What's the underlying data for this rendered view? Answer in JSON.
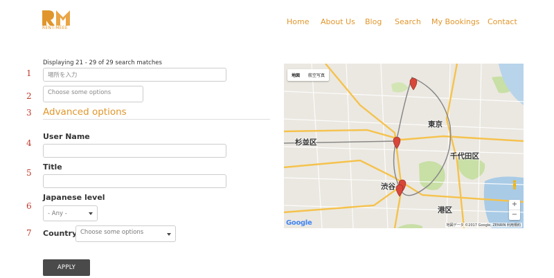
{
  "header": {
    "logo_text": "RENT-MEEE",
    "nav": [
      "Home",
      "About Us",
      "Blog",
      "Search",
      "My Bookings",
      "Contact"
    ]
  },
  "results": {
    "count_text": "Displaying 21 - 29 of 29 search matches"
  },
  "row_numbers": [
    "1",
    "2",
    "3",
    "4",
    "5",
    "6",
    "7"
  ],
  "form": {
    "location_placeholder": "場所を入力",
    "options_placeholder": "Choose some options",
    "advanced_title": "Advanced options",
    "user_name_label": "User Name",
    "user_name_value": "",
    "title_label": "Title",
    "title_value": "",
    "japanese_level_label": "Japanese level",
    "japanese_level_value": "- Any -",
    "country_label": "Country",
    "country_placeholder": "Choose some options",
    "apply_label": "APPLY"
  },
  "map": {
    "toggle": [
      "地図",
      "航空写真"
    ],
    "labels": [
      "東京",
      "杉並区",
      "千代田区",
      "渋谷",
      "港区"
    ],
    "zoom_in": "+",
    "zoom_out": "−",
    "google_logo": "Google",
    "attribution": "地図データ ©2017 Google, ZENRIN 利用規約",
    "colors": {
      "pin": "#d9463a",
      "park": "#c8dfa5",
      "water": "#a9cbe6",
      "road": "#f5c24c"
    }
  },
  "colors": {
    "accent": "#e0962c",
    "row_number": "#c0392b",
    "button": "#4a4a4a"
  }
}
